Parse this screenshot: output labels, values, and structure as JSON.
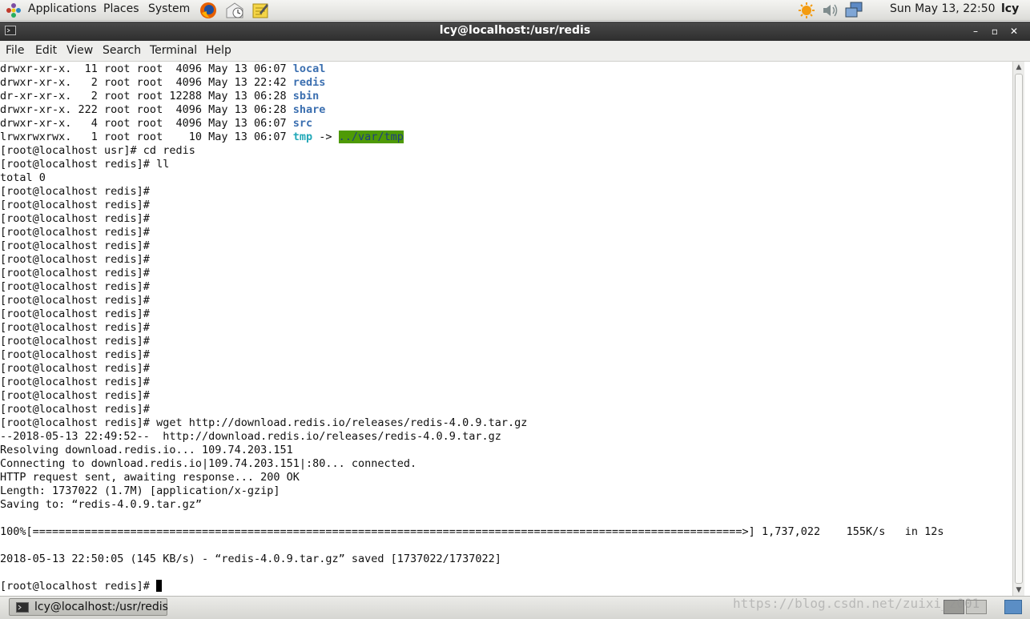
{
  "top_panel": {
    "menus": [
      "Applications",
      "Places",
      "System"
    ],
    "launchers": [
      "firefox-icon",
      "evolution-icon",
      "notes-icon"
    ],
    "tray_icons": [
      "weather-icon",
      "volume-icon",
      "network-icon"
    ],
    "clock": "Sun May 13, 22:50",
    "user": "lcy"
  },
  "window": {
    "title": "lcy@localhost:/usr/redis",
    "controls": [
      "minimize",
      "maximize",
      "close"
    ]
  },
  "menubar": [
    "File",
    "Edit",
    "View",
    "Search",
    "Terminal",
    "Help"
  ],
  "terminal": {
    "lines": [
      {
        "text": "drwxr-xr-x.  11 root root  4096 May 13 06:07 ",
        "name": "local",
        "type": "dir"
      },
      {
        "text": "drwxr-xr-x.   2 root root  4096 May 13 22:42 ",
        "name": "redis",
        "type": "dir"
      },
      {
        "text": "dr-xr-xr-x.   2 root root 12288 May 13 06:28 ",
        "name": "sbin",
        "type": "dir"
      },
      {
        "text": "drwxr-xr-x. 222 root root  4096 May 13 06:28 ",
        "name": "share",
        "type": "dir"
      },
      {
        "text": "drwxr-xr-x.   4 root root  4096 May 13 06:07 ",
        "name": "src",
        "type": "dir"
      },
      {
        "text": "lrwxrwxrwx.   1 root root    10 May 13 06:07 ",
        "name": "tmp",
        "type": "link",
        "arrow": " -> ",
        "target": "../var/tmp"
      },
      {
        "text": "[root@localhost usr]# cd redis"
      },
      {
        "text": "[root@localhost redis]# ll"
      },
      {
        "text": "total 0"
      },
      {
        "text": "[root@localhost redis]#"
      },
      {
        "text": "[root@localhost redis]#"
      },
      {
        "text": "[root@localhost redis]#"
      },
      {
        "text": "[root@localhost redis]#"
      },
      {
        "text": "[root@localhost redis]#"
      },
      {
        "text": "[root@localhost redis]#"
      },
      {
        "text": "[root@localhost redis]#"
      },
      {
        "text": "[root@localhost redis]#"
      },
      {
        "text": "[root@localhost redis]#"
      },
      {
        "text": "[root@localhost redis]#"
      },
      {
        "text": "[root@localhost redis]#"
      },
      {
        "text": "[root@localhost redis]#"
      },
      {
        "text": "[root@localhost redis]#"
      },
      {
        "text": "[root@localhost redis]#"
      },
      {
        "text": "[root@localhost redis]#"
      },
      {
        "text": "[root@localhost redis]#"
      },
      {
        "text": "[root@localhost redis]#"
      },
      {
        "text": "[root@localhost redis]# wget http://download.redis.io/releases/redis-4.0.9.tar.gz"
      },
      {
        "text": "--2018-05-13 22:49:52--  http://download.redis.io/releases/redis-4.0.9.tar.gz"
      },
      {
        "text": "Resolving download.redis.io... 109.74.203.151"
      },
      {
        "text": "Connecting to download.redis.io|109.74.203.151|:80... connected."
      },
      {
        "text": "HTTP request sent, awaiting response... 200 OK"
      },
      {
        "text": "Length: 1737022 (1.7M) [application/x-gzip]"
      },
      {
        "text": "Saving to: “redis-4.0.9.tar.gz”"
      },
      {
        "text": ""
      },
      {
        "text": "100%[=============================================================================================================>] 1,737,022    155K/s   in 12s"
      },
      {
        "text": ""
      },
      {
        "text": "2018-05-13 22:50:05 (145 KB/s) - “redis-4.0.9.tar.gz” saved [1737022/1737022]"
      },
      {
        "text": ""
      },
      {
        "text": "[root@localhost redis]# ",
        "cursor": true
      }
    ]
  },
  "taskbar": {
    "task_label": "lcy@localhost:/usr/redis"
  },
  "watermark": "https://blog.csdn.net/zuixi_z001"
}
